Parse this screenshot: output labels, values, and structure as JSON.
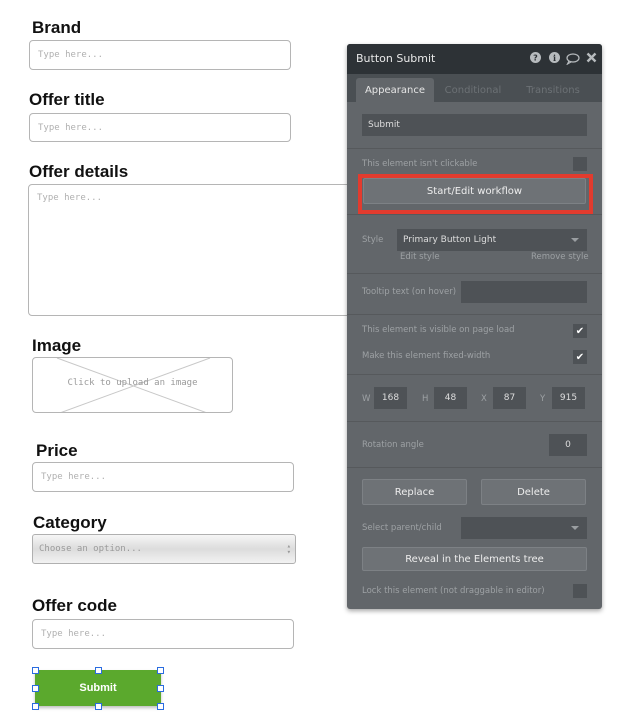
{
  "form": {
    "brand": {
      "label": "Brand",
      "placeholder": "Type here..."
    },
    "offer_title": {
      "label": "Offer title",
      "placeholder": "Type here..."
    },
    "offer_details": {
      "label": "Offer details",
      "placeholder": "Type here..."
    },
    "image": {
      "label": "Image",
      "upload_text": "Click to upload an image"
    },
    "price": {
      "label": "Price",
      "placeholder": "Type here..."
    },
    "category": {
      "label": "Category",
      "placeholder": "Choose an option..."
    },
    "offer_code": {
      "label": "Offer code",
      "placeholder": "Type here..."
    },
    "submit_label": "Submit"
  },
  "panel": {
    "title": "Button Submit",
    "icons": [
      "help-icon",
      "info-icon",
      "comment-icon",
      "close-icon"
    ],
    "tabs": [
      {
        "label": "Appearance",
        "active": true
      },
      {
        "label": "Conditional",
        "active": false
      },
      {
        "label": "Transitions",
        "active": false
      }
    ],
    "button_text": "Submit",
    "not_clickable_label": "This element isn't clickable",
    "not_clickable_checked": false,
    "workflow_button": "Start/Edit workflow",
    "style_label": "Style",
    "style_value": "Primary Button Light",
    "edit_style": "Edit style",
    "remove_style": "Remove style",
    "tooltip_label": "Tooltip text (on hover)",
    "tooltip_value": "",
    "visible_label": "This element is visible on page load",
    "visible_checked": true,
    "fixed_width_label": "Make this element fixed-width",
    "fixed_width_checked": true,
    "dims": {
      "w_label": "W",
      "w": "168",
      "h_label": "H",
      "h": "48",
      "x_label": "X",
      "x": "87",
      "y_label": "Y",
      "y": "915"
    },
    "rotation_label": "Rotation angle",
    "rotation_value": "0",
    "replace_button": "Replace",
    "delete_button": "Delete",
    "parent_child_label": "Select parent/child",
    "reveal_button": "Reveal in the Elements tree",
    "lock_label": "Lock this element (not draggable in editor)",
    "lock_checked": false,
    "checkmark": "✔"
  },
  "colors": {
    "submit_green": "#5ba92d",
    "highlight_red": "#e23b2e",
    "panel_bg": "#62666a",
    "panel_header": "#2d3236"
  }
}
